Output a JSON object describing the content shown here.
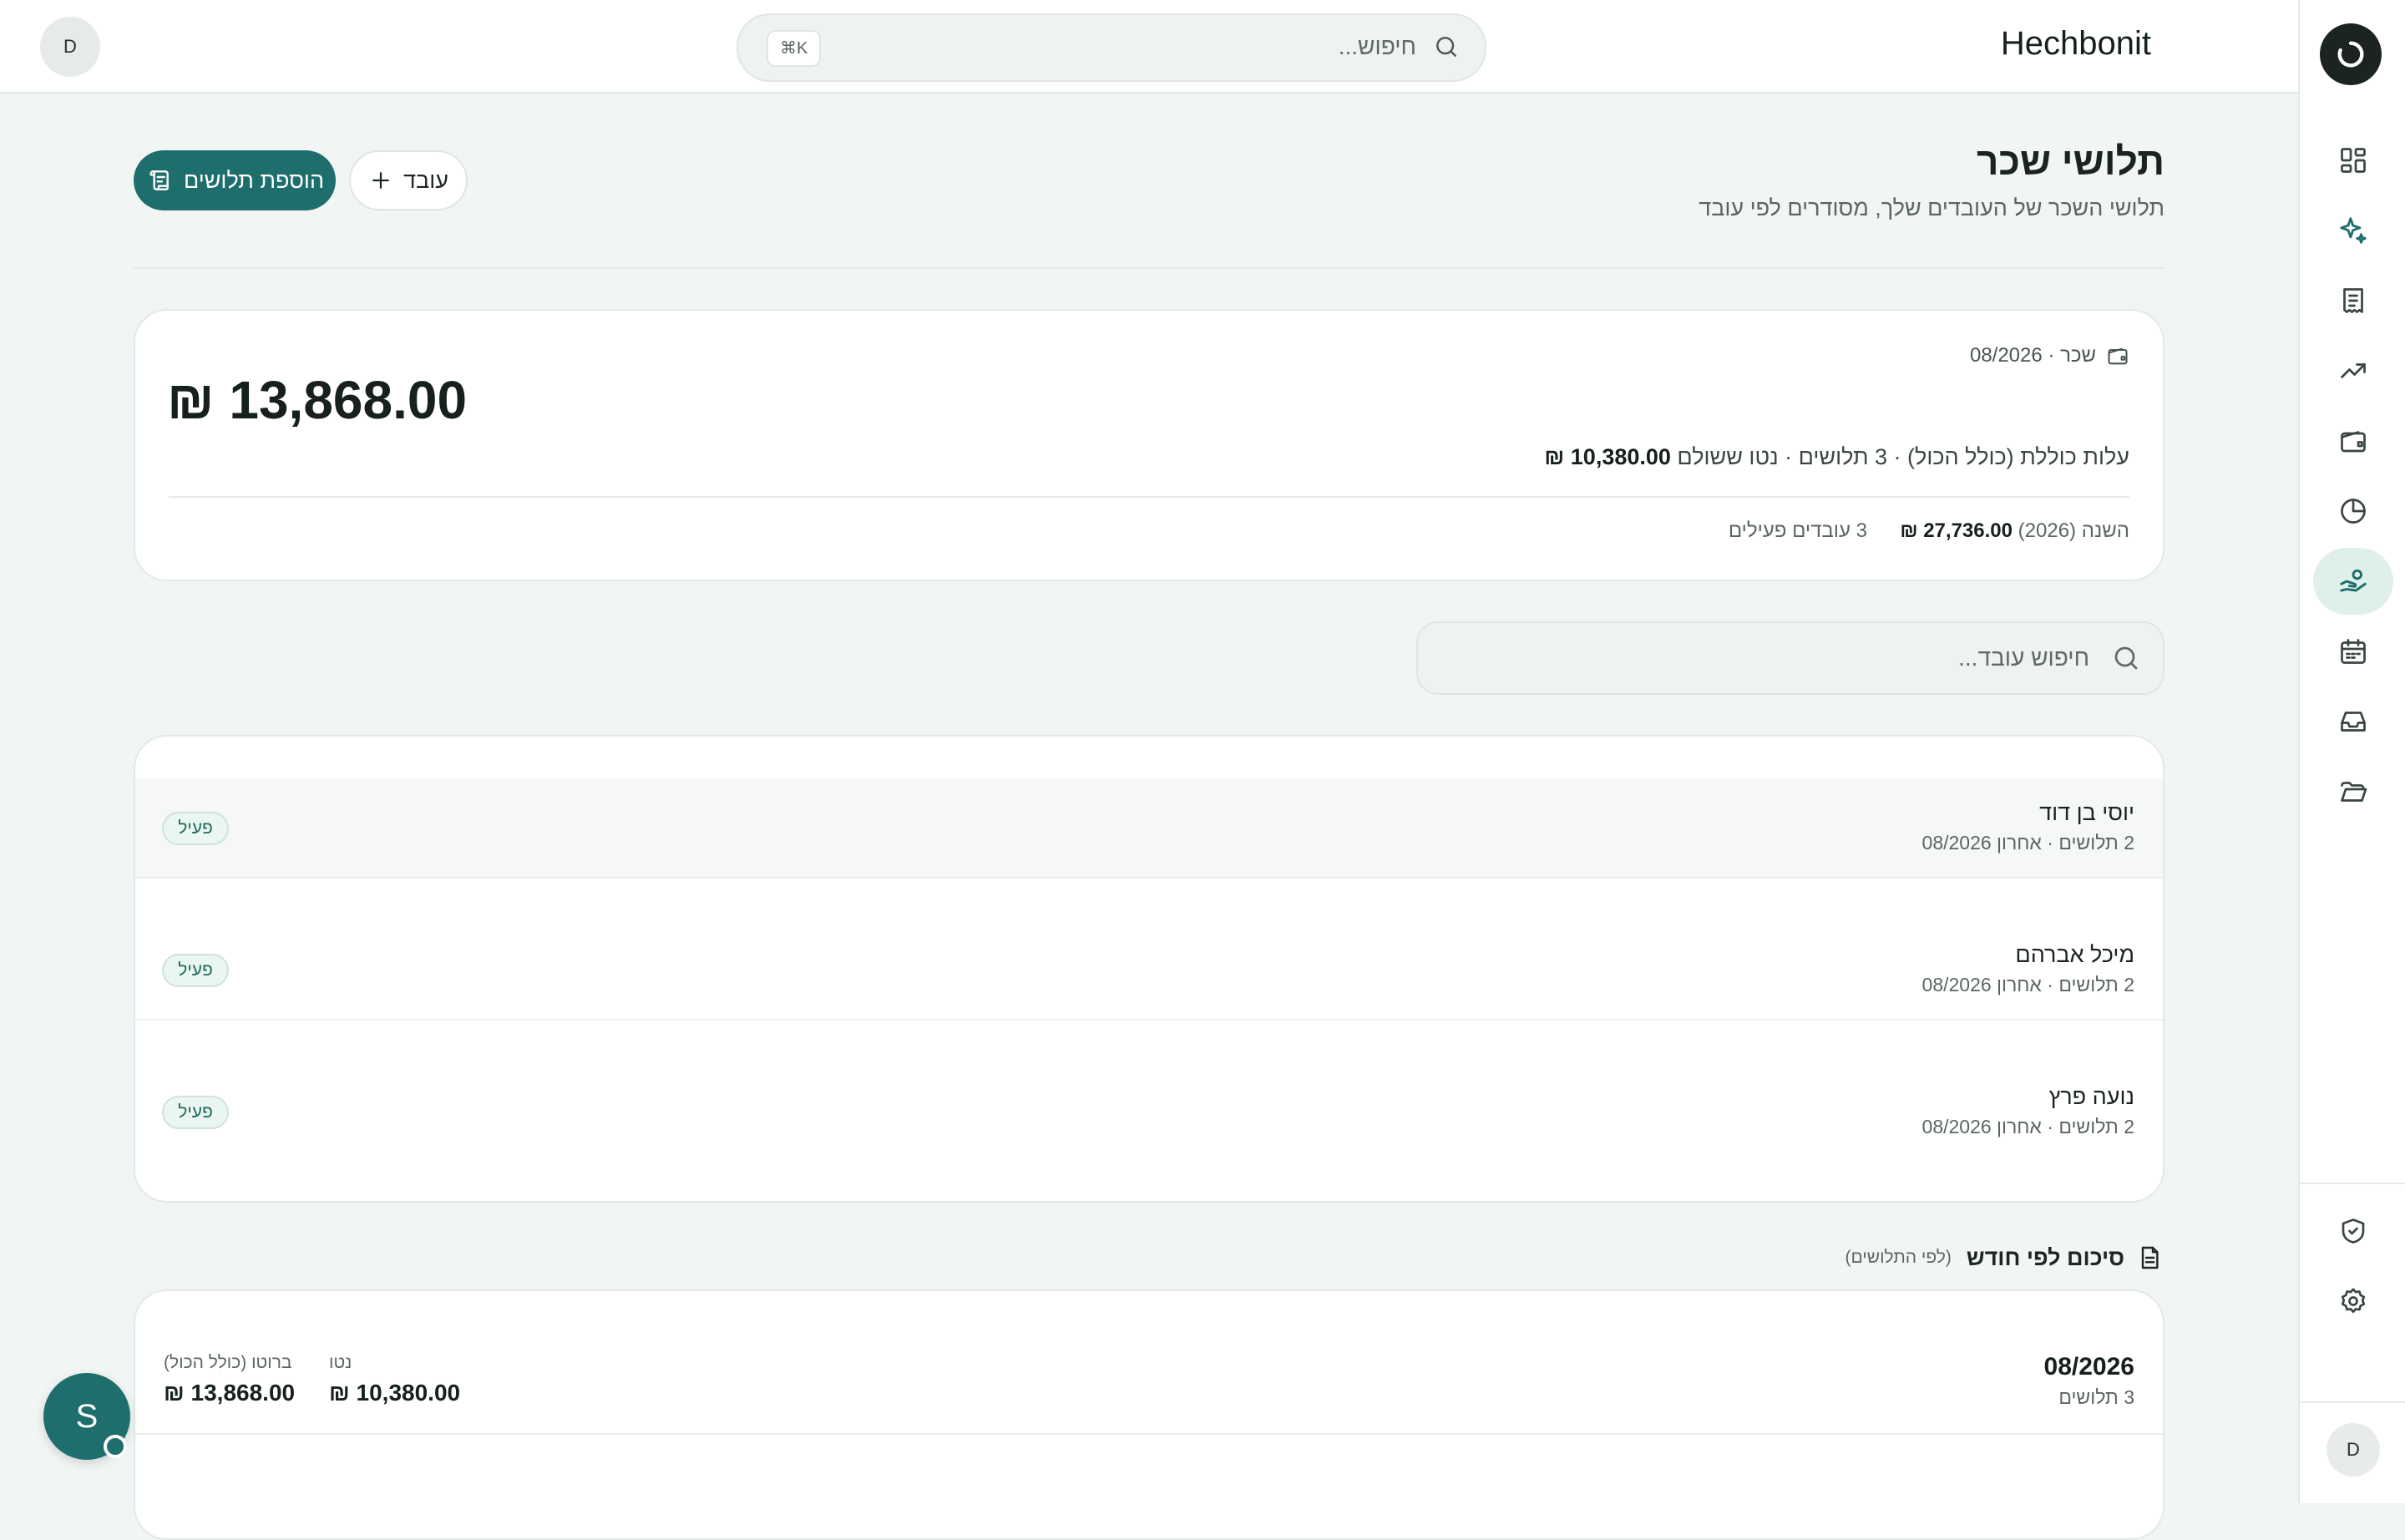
{
  "topbar": {
    "brand": "Hechbonit",
    "search_placeholder": "חיפוש...",
    "shortcut": "⌘K",
    "avatar_initial": "D"
  },
  "rail": {
    "items": [
      {
        "icon": "dashboard-grid-icon",
        "active": false
      },
      {
        "icon": "sparkles-icon",
        "active": false
      },
      {
        "icon": "receipt-icon",
        "active": false
      },
      {
        "icon": "trending-up-icon",
        "active": false
      },
      {
        "icon": "wallet-icon",
        "active": false
      },
      {
        "icon": "pie-chart-icon",
        "active": false
      },
      {
        "icon": "hand-coins-icon",
        "active": true
      },
      {
        "icon": "calendar-icon",
        "active": false
      },
      {
        "icon": "inbox-icon",
        "active": false
      },
      {
        "icon": "folder-open-icon",
        "active": false
      }
    ],
    "bottom_items": [
      {
        "icon": "shield-check-icon"
      },
      {
        "icon": "settings-gear-icon"
      }
    ],
    "avatar_initial": "D"
  },
  "header": {
    "title": "תלושי שכר",
    "subtitle": "תלושי השכר של העובדים שלך, מסודרים לפי עובד",
    "add_payslips_label": "הוספת תלושים",
    "add_employee_label": "עובד"
  },
  "summary": {
    "period": "שכר · 08/2026",
    "total": "₪ 13,868.00",
    "details_prefix": "עלות כוללת (כולל הכול) · 3 תלושים · נטו ששולם",
    "net_paid": "₪ 10,380.00",
    "year_label": "השנה (2026)",
    "year_total": "₪ 27,736.00",
    "active_employees": "3 עובדים פעילים"
  },
  "employee_search": {
    "placeholder": "חיפוש עובד..."
  },
  "employees": [
    {
      "name": "יוסי בן דוד",
      "meta": "2 תלושים · אחרון 08/2026",
      "status": "פעיל"
    },
    {
      "name": "מיכל אברהם",
      "meta": "2 תלושים · אחרון 08/2026",
      "status": "פעיל"
    },
    {
      "name": "נועה פרץ",
      "meta": "2 תלושים · אחרון 08/2026",
      "status": "פעיל"
    }
  ],
  "monthly": {
    "title": "סיכום לפי חודש",
    "subtitle": "(לפי התלושים)",
    "rows": [
      {
        "period": "08/2026",
        "count": "3 תלושים",
        "net_label": "נטו",
        "net": "₪ 10,380.00",
        "gross_label": "ברוטו (כולל הכול)",
        "gross": "₪ 13,868.00"
      }
    ]
  },
  "assistant": {
    "initial": "S"
  },
  "colors": {
    "accent": "#1d6e6c",
    "background": "#f1f5f3",
    "active_badge_bg": "#eaf6f1"
  }
}
